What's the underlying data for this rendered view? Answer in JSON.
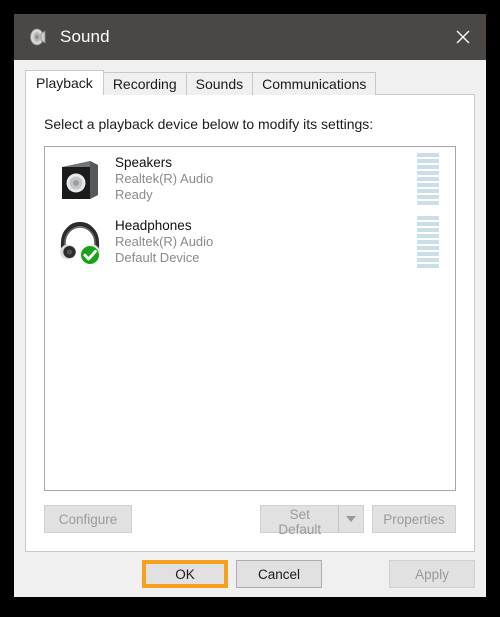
{
  "window": {
    "title": "Sound",
    "icon": "speaker-icon",
    "close_label": "✕"
  },
  "tabs": [
    {
      "label": "Playback",
      "active": true
    },
    {
      "label": "Recording",
      "active": false
    },
    {
      "label": "Sounds",
      "active": false
    },
    {
      "label": "Communications",
      "active": false
    }
  ],
  "playback": {
    "instruction": "Select a playback device below to modify its settings:",
    "devices": [
      {
        "name": "Speakers",
        "driver": "Realtek(R) Audio",
        "status": "Ready",
        "icon": "speaker-box-icon",
        "default": false,
        "meter_segments": 9
      },
      {
        "name": "Headphones",
        "driver": "Realtek(R) Audio",
        "status": "Default Device",
        "icon": "headphones-icon",
        "default": true,
        "badge": "green-check-badge",
        "meter_segments": 9
      }
    ],
    "buttons": {
      "configure": "Configure",
      "set_default": "Set Default",
      "set_default_arrow": "dropdown-arrow-icon",
      "properties": "Properties"
    }
  },
  "footer": {
    "ok": "OK",
    "cancel": "Cancel",
    "apply": "Apply"
  },
  "colors": {
    "titlebar": "#4a4744",
    "highlight": "#f5a01e",
    "meter": "#cadfe8",
    "default_badge": "#16a316"
  }
}
